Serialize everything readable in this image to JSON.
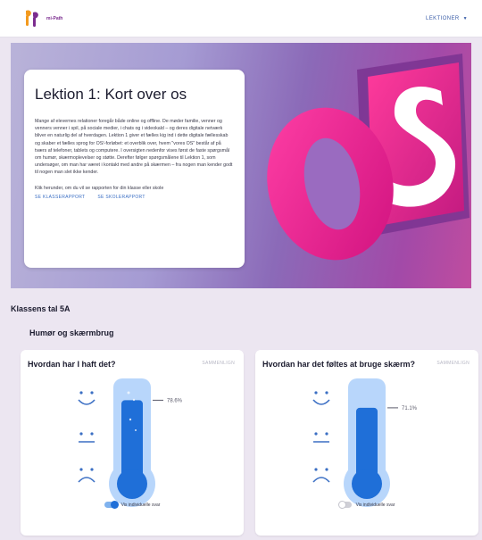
{
  "header": {
    "logo_text": "mi-Path",
    "nav_label": "LEKTIONER"
  },
  "hero": {
    "title": "Lektion 1: Kort over os",
    "body": "Mange af elevernes relationer foregår både online og offline. De møder familie, venner og venners venner i spil, på sociale medier, i chats og i videokald – og deres digitale netværk bliver en naturlig del af hverdagen. Lektion 1 giver et fælles kig ind i dette digitale fællesskab og skaber et fælles sprog for OS!-forløbet: et overblik over, hvem \"vores OS\" består af på tværs af telefoner, tablets og computere. I oversigten nedenfor vises først de faste spørgsmål om humør, skærmoplevelser og støtte. Derefter følger spørgsmålene til Lektion 1, som undersøger, om man har været i kontakt med andre på skærmen – fra nogen man kender godt til nogen man slet ikke kender.",
    "cta": "Klik herunder, om du vil se rapporten for din klasse eller skole",
    "link_class": "SE KLASSERAPPORT",
    "link_school": "SE SKOLERAPPORT",
    "art_text": "OS"
  },
  "section": {
    "title": "Klassens tal 5A",
    "subtitle": "Humør og skærmbrug"
  },
  "cards": [
    {
      "title": "Hvordan har I haft det?",
      "compare": "SAMMENLIGN",
      "percent_label": "78.6%",
      "fill": 0.786,
      "toggle_on": true,
      "toggle_label": "Vis individuelle svar"
    },
    {
      "title": "Hvordan har det føltes at bruge skærm?",
      "compare": "SAMMENLIGN",
      "percent_label": "71.1%",
      "fill": 0.711,
      "toggle_on": false,
      "toggle_label": "Vis individuelle svar"
    }
  ],
  "colors": {
    "accent_blue": "#1f6fd8",
    "thermo_light": "#b8d6fb",
    "logo_purple": "#7b2c8f",
    "logo_orange": "#f39a1e",
    "art_pink": "#e2208a"
  }
}
